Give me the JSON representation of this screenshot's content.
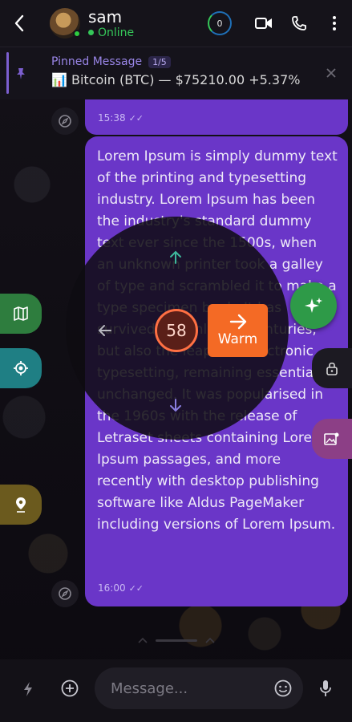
{
  "header": {
    "name": "sam",
    "status": "Online",
    "counter": "0"
  },
  "pinned": {
    "label": "Pinned Message",
    "count": "1/5",
    "message": "📊 Bitcoin (BTC) — $75210.00 +5.37%"
  },
  "messages": [
    {
      "time": "15:38",
      "text": ""
    },
    {
      "time": "16:00",
      "text": "Lorem Ipsum is simply dummy text of the printing and typesetting industry. Lorem Ipsum has been the industry's standard dummy text ever since the 1500s, when an unknown printer took a galley of type and scrambled it to make a type specimen book. It has survived not only five centuries, but also the leap into electronic typesetting, remaining essentially unchanged. It was popularised in the 1960s with the release of Letraset sheets containing Lorem Ipsum passages, and more recently with desktop publishing software like Aldus PageMaker including versions of Lorem Ipsum."
    }
  ],
  "radial": {
    "value": "58",
    "action_label": "Warm"
  },
  "input": {
    "placeholder": "Message..."
  },
  "colors": {
    "bubble": "#6a36c8",
    "accent": "#7c5fd0",
    "warm": "#f46a25",
    "online": "#35c759"
  }
}
